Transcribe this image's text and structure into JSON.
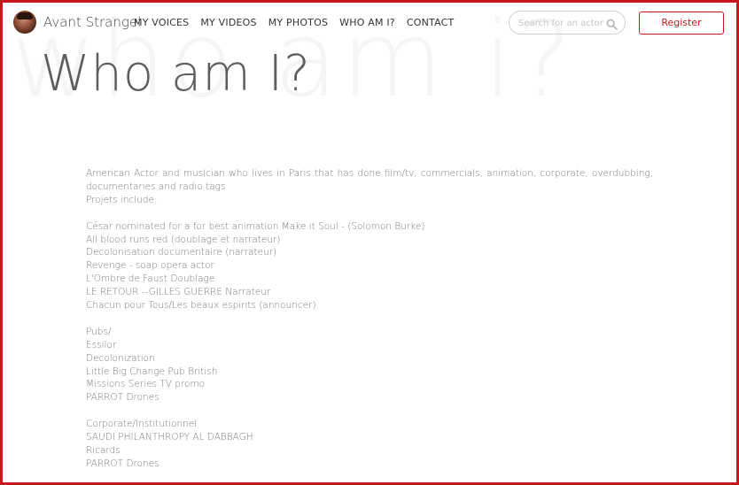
{
  "header": {
    "brand": "Avant Strangel",
    "nav": [
      "MY VOICES",
      "MY VIDEOS",
      "MY PHOTOS",
      "WHO AM I?",
      "CONTACT"
    ],
    "search": {
      "placeholder": "Search for an actor",
      "icon": "search-icon"
    },
    "register_label": "Register"
  },
  "page": {
    "watermark": "who am i?",
    "title": "Who am I?"
  },
  "bio": {
    "intro": "American Actor and musician who lives in Paris that has done film/tv, commercials, animation, corporate, overdubbing, documentaries and radio tags",
    "projects_heading": "Projets include:",
    "projects": [
      "César nominated for a for best animation Make it Soul - (Solomon Burke)",
      "All blood runs red (doublage et narrateur)",
      "Decolonisation documentaire (narrateur)",
      "Revenge - soap opera actor",
      "L'Ombre de Faust Doublage",
      "LE RETOUR --GILLES GUERRE Narrateur",
      "Chacun pour Tous/Les beaux espirits (announcer)"
    ],
    "pubs_heading": "Pubs/",
    "pubs": [
      "Essilor",
      "Decolonization",
      "Little Big Change Pub British",
      "Missions Series TV promo",
      "PARROT Drones"
    ],
    "corporate_heading": "Corporate/Institutionnel",
    "corporate": [
      "SAUDI PHILANTHROPY AL DABBAGH",
      "Ricards",
      "PARROT Drones"
    ]
  },
  "colors": {
    "accent": "#c8161d",
    "text": "#7a7a7a"
  }
}
